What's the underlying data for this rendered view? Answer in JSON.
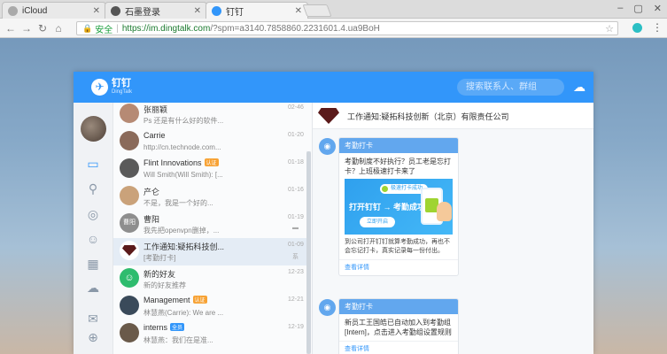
{
  "browser": {
    "tabs": [
      {
        "label": "iCloud",
        "icon": "apple-icon",
        "color": "#aaaaaa"
      },
      {
        "label": "石墨登录",
        "icon": "shimo-icon",
        "color": "#666666"
      },
      {
        "label": "钉钉",
        "icon": "dingtalk-icon",
        "color": "#3296fa"
      }
    ],
    "secure_label": "安全",
    "url_host": "https://im.dingtalk.com",
    "url_rest": "/?spm=a3140.7858860.2231601.4.ua9BoH"
  },
  "app": {
    "logo_text": "钉钉",
    "logo_sub": "DingTalk",
    "search_placeholder": "搜索联系人、群组",
    "accent_color": "#3296fa"
  },
  "conversations": [
    {
      "name": "张丽颖",
      "badge": "",
      "time": "02-46",
      "msg": "Ps 还是有什么好的软件...",
      "mark": "",
      "avatar": "#b68a74",
      "avatar_text": ""
    },
    {
      "name": "Carrie",
      "badge": "",
      "time": "01-20",
      "msg": "http://cn.technode.com...",
      "mark": "",
      "avatar": "#8a6a5a",
      "avatar_text": ""
    },
    {
      "name": "Flint Innovations",
      "badge": "认证",
      "badge_color": "orange",
      "time": "01-18",
      "msg": "Will Smith(Will Smith): [...",
      "mark": "",
      "avatar": "#5a5a5a",
      "avatar_text": ""
    },
    {
      "name": "产仑",
      "badge": "",
      "time": "01-16",
      "msg": "不是，我是一个好的...",
      "mark": "",
      "avatar": "#caa27a",
      "avatar_text": ""
    },
    {
      "name": "曹阳",
      "badge": "",
      "time": "01-19",
      "msg": "我先把openvpn删掉，...",
      "mark": "",
      "avatar": "#8e8e8e",
      "avatar_text": "曹阳"
    },
    {
      "name": "工作通知:疑拓科技创...",
      "badge": "",
      "time": "01-09",
      "msg": "[考勤打卡]",
      "mark": "系",
      "avatar": "#5b1a1a",
      "avatar_text": ""
    },
    {
      "name": "新的好友",
      "badge": "",
      "time": "12-23",
      "msg": "新的好友推荐",
      "mark": "",
      "avatar": "#2ebc6e",
      "avatar_text": ""
    },
    {
      "name": "Management",
      "badge": "认证",
      "badge_color": "orange",
      "time": "12-21",
      "msg": "林慧燕(Carrie): We are ...",
      "mark": "",
      "avatar": "#3a4a5a",
      "avatar_text": ""
    },
    {
      "name": "interns",
      "badge": "全员",
      "badge_color": "blue",
      "time": "12-19",
      "msg": "林慧燕：我们在是准...",
      "mark": "",
      "avatar": "#6a5a4a",
      "avatar_text": ""
    }
  ],
  "chat": {
    "title": "工作通知:疑拓科技创新（北京）有限责任公司",
    "cards": [
      {
        "head": "考勤打卡",
        "title": "考勤制度不好执行？员工老是忘打卡？上班极速打卡来了",
        "banner_pill": "极速打卡成功",
        "banner_text": "打开钉钉 → 考勤成功",
        "banner_button": "立即开启",
        "body": "到公司打开钉钉就算考勤成功，再也不会忘记打卡，真实记录每一份付出。",
        "link": "查看详情"
      },
      {
        "head": "考勤打卡",
        "title": "新员工王国皓已自动加入到考勤组[Intern]，点击进入考勤组设置规则",
        "link": "查看详情"
      }
    ]
  }
}
